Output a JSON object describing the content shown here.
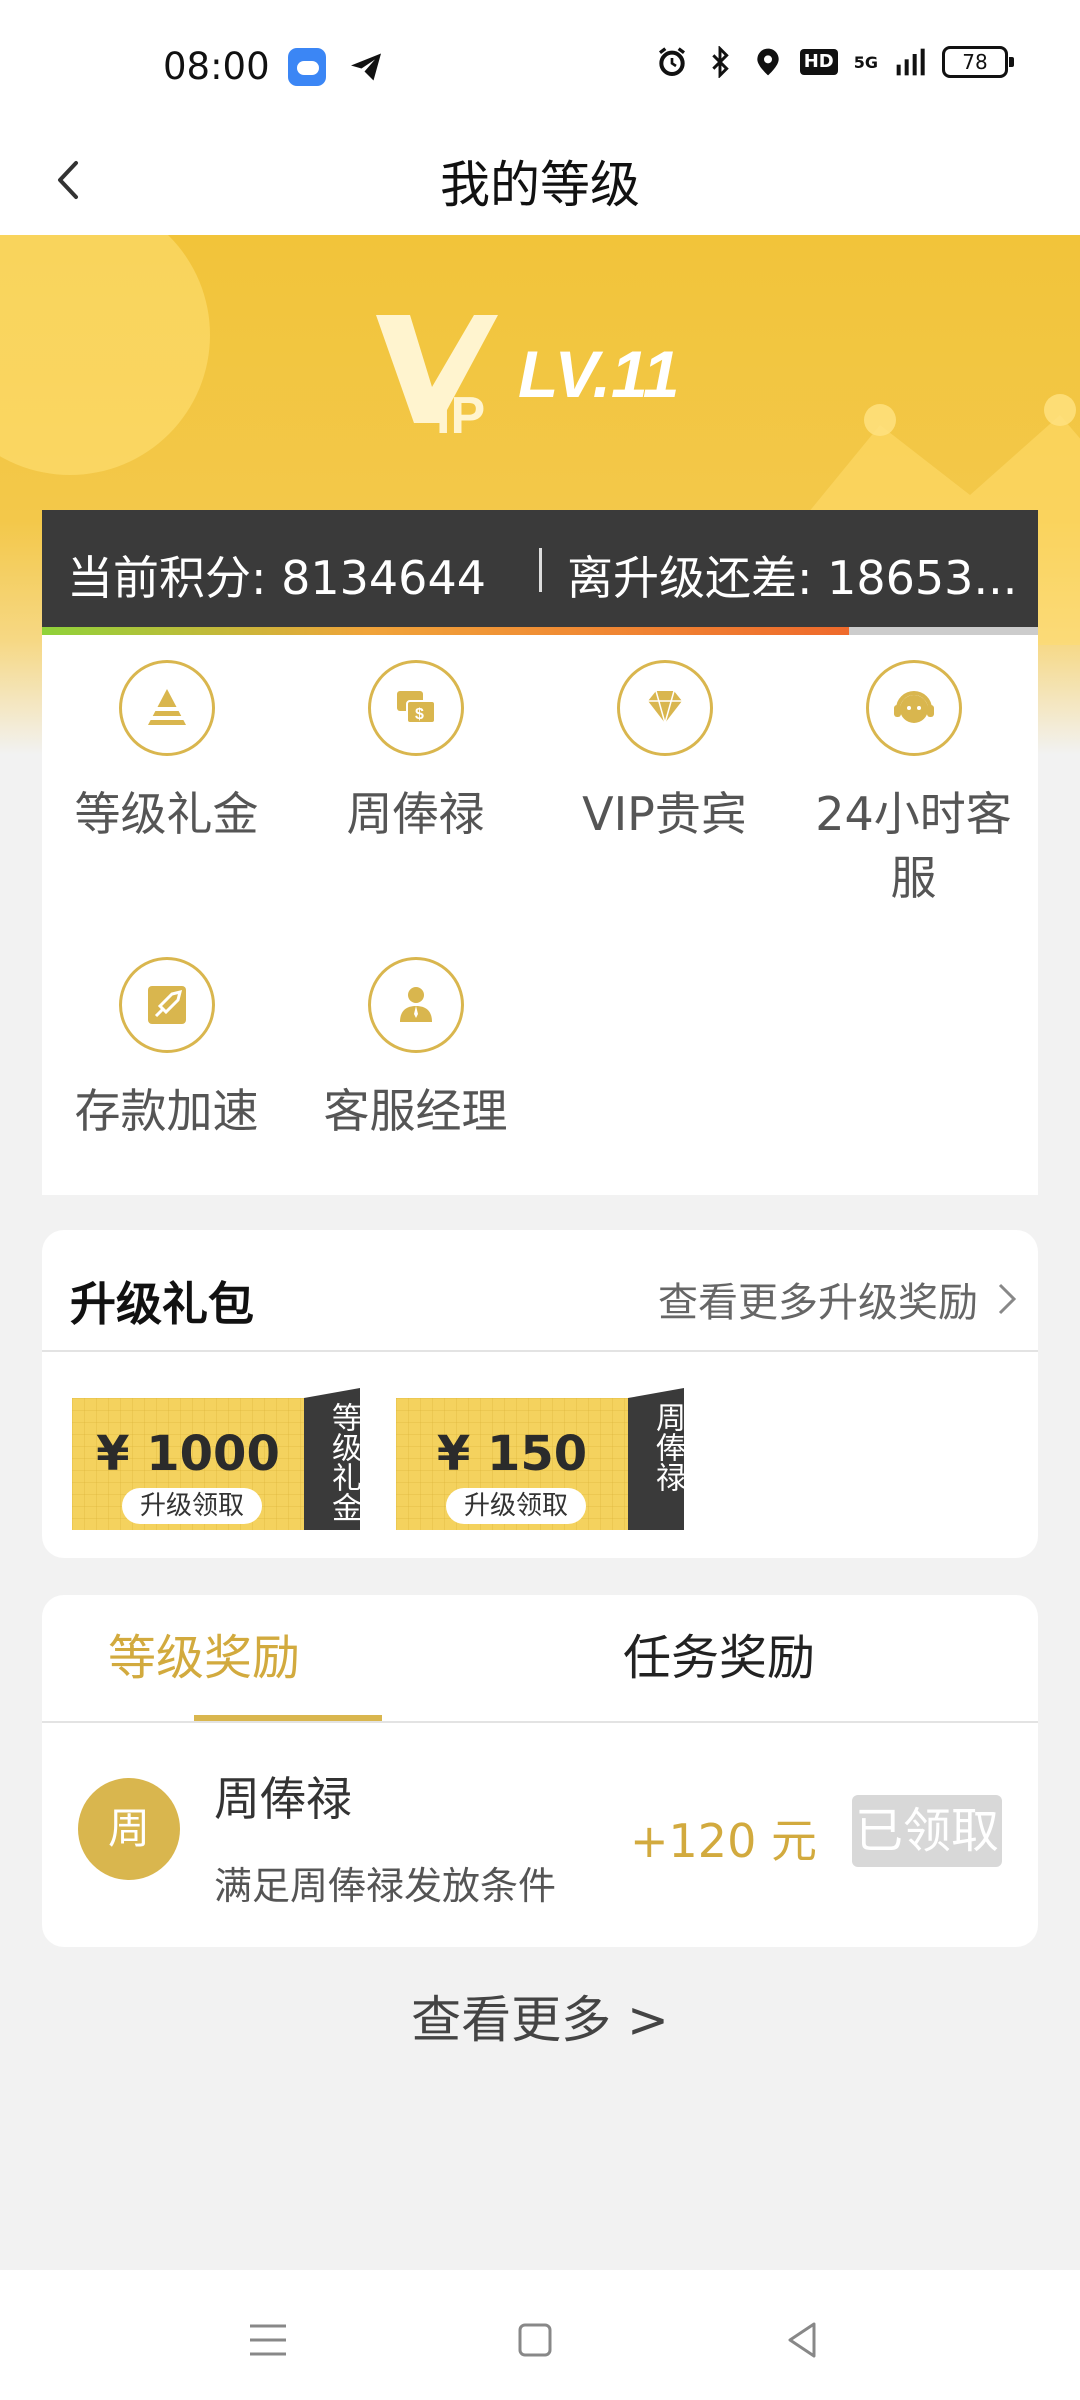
{
  "status_bar": {
    "time": "08:00",
    "battery": "78",
    "network": "5G",
    "hd": "HD"
  },
  "header": {
    "title": "我的等级"
  },
  "vip": {
    "level": "LV.11",
    "badge_text": "VIP",
    "accent_color": "#f2c43a"
  },
  "points": {
    "current_label": "当前积分: 8134644",
    "remaining_label": "离升级还差: 18653...",
    "progress": 0.81
  },
  "benefits": [
    {
      "label": "等级礼金",
      "icon": "pyramid-icon"
    },
    {
      "label": "周俸禄",
      "icon": "money-chat-icon"
    },
    {
      "label": "VIP贵宾",
      "icon": "diamond-icon"
    },
    {
      "label": "24小时客服",
      "icon": "headset-icon"
    },
    {
      "label": "存款加速",
      "icon": "rocket-icon"
    },
    {
      "label": "客服经理",
      "icon": "manager-icon"
    }
  ],
  "upgrade_gifts": {
    "title": "升级礼包",
    "more_label": "查看更多升级奖励",
    "coupons": [
      {
        "amount": "¥ 1000",
        "action": "升级领取",
        "tag": "等级礼金"
      },
      {
        "amount": "¥ 150",
        "action": "升级领取",
        "tag": "周俸禄"
      }
    ]
  },
  "rewards": {
    "tabs": [
      "等级奖励",
      "任务奖励"
    ],
    "active_tab": 0,
    "items": [
      {
        "avatar": "周",
        "name": "周俸禄",
        "desc": "满足周俸禄发放条件",
        "amount": "+120 元",
        "status": "已领取"
      }
    ]
  },
  "see_more": "查看更多 >"
}
